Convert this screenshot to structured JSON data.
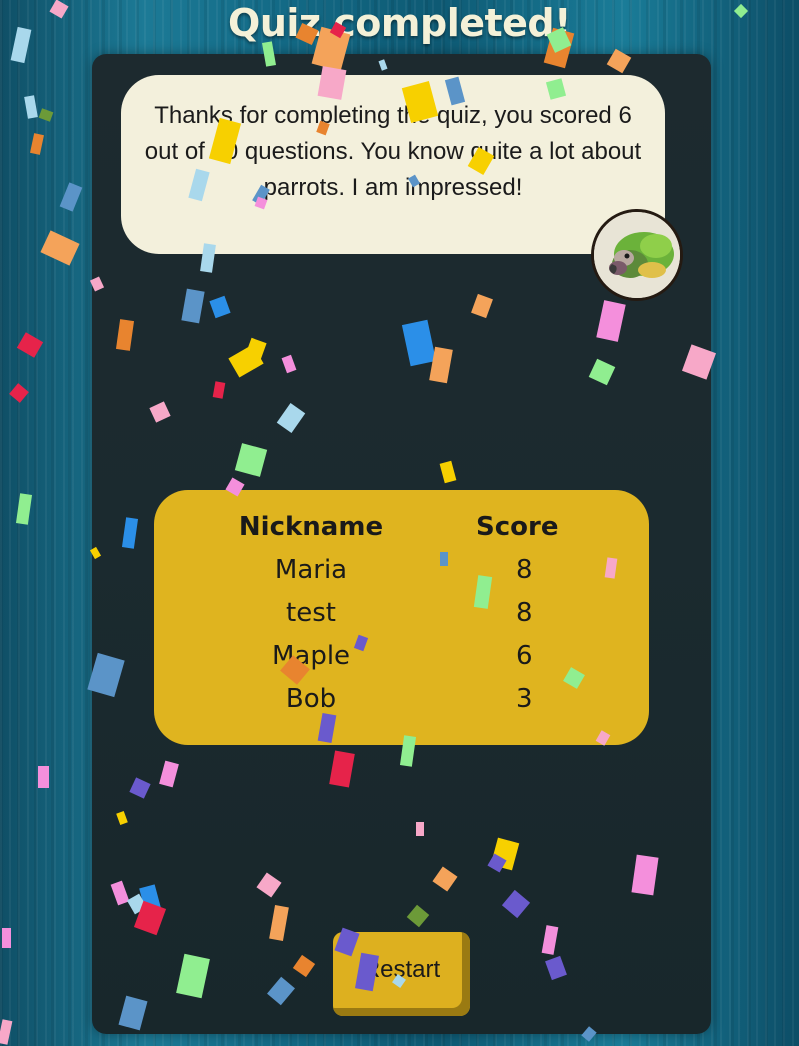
{
  "page": {
    "title": "Quiz completed!"
  },
  "result": {
    "message": "Thanks for completing the quiz, you scored 6 out of 10 questions. You know quite a lot about parrots. I am impressed!",
    "avatar_icon": "parrot-avatar-icon"
  },
  "leaderboard": {
    "headers": {
      "nickname": "Nickname",
      "score": "Score"
    },
    "rows": [
      {
        "nickname": "Maria",
        "score": "8"
      },
      {
        "nickname": "test",
        "score": "8"
      },
      {
        "nickname": "Maple",
        "score": "6"
      },
      {
        "nickname": "Bob",
        "score": "3"
      }
    ]
  },
  "actions": {
    "restart_label": "Restart"
  },
  "colors": {
    "background": "#136a86",
    "card": "#1b2a2f",
    "bubble": "#f3f0dc",
    "leaderboard": "#dfb41f",
    "button": "#ddb01f",
    "title": "#f4f1d8"
  }
}
